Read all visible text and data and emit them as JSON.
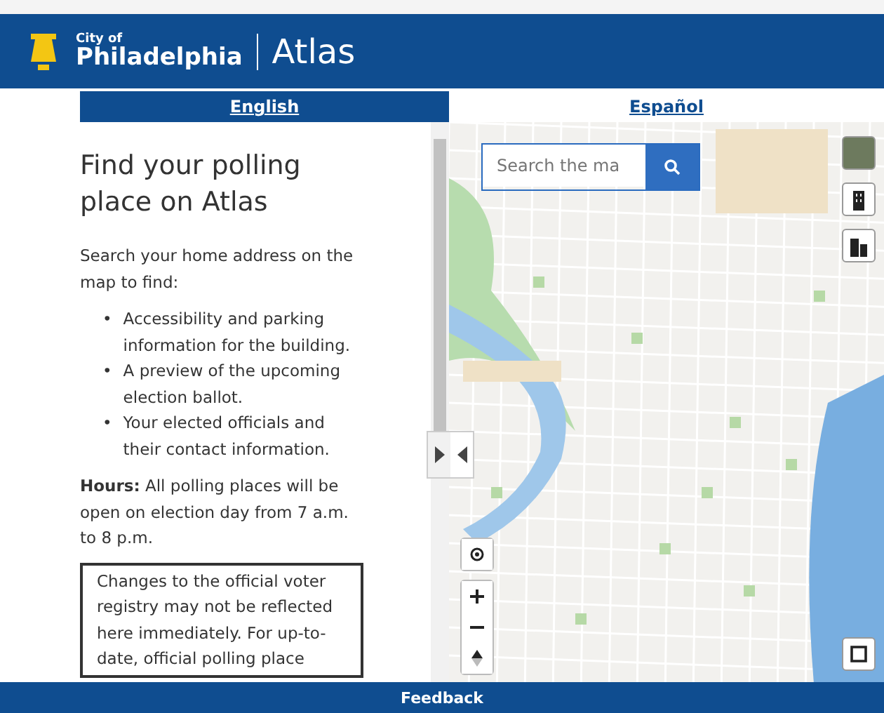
{
  "header": {
    "logo_small": "City of",
    "logo_large": "Philadelphia",
    "app_title": "Atlas"
  },
  "tabs": [
    {
      "label": "English",
      "selected": true
    },
    {
      "label": "Español",
      "selected": false
    }
  ],
  "panel": {
    "heading": "Find your polling place on Atlas",
    "intro": "Search your home address on the map to find:",
    "bullets": [
      {
        "marker": "•",
        "text": "Accessibility and parking information for the building."
      },
      {
        "marker": "•",
        "text": "A preview of the upcoming election ballot."
      },
      {
        "marker": "•",
        "text": "Your elected officials and their contact information."
      }
    ],
    "hours": "**Hours:** All polling places will be open on election day from 7 a.m. to 8 p.m.",
    "notice": "Changes to the official voter registry may not be reflected here immediately. For up-to-date, official polling place"
  },
  "map": {
    "search": {
      "placeholder": "Search the ma"
    }
  },
  "footer": {
    "label": "Feedback"
  }
}
